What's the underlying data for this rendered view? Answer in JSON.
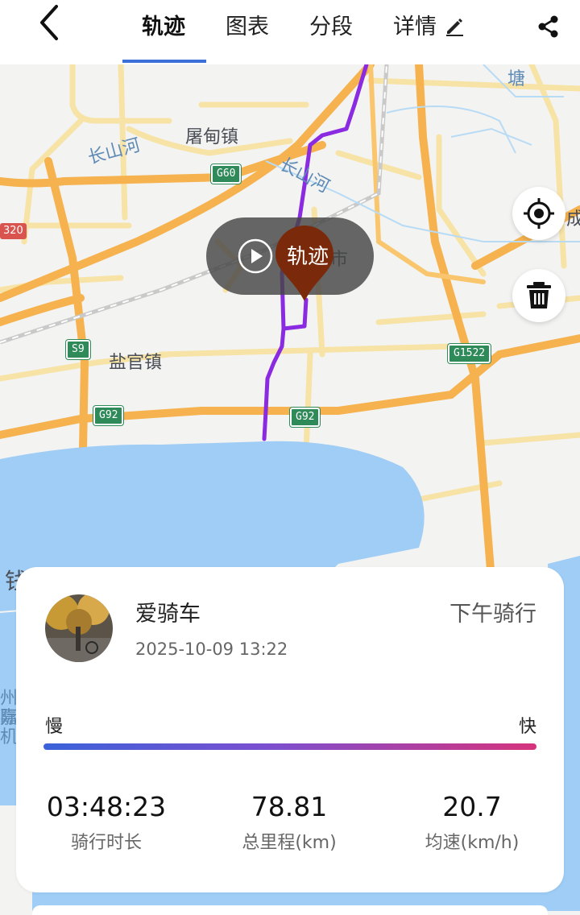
{
  "header": {
    "tabs": [
      {
        "label": "轨迹"
      },
      {
        "label": "图表"
      },
      {
        "label": "分段"
      },
      {
        "label": "详情"
      }
    ]
  },
  "map": {
    "places": [
      "屠甸镇",
      "盐官镇",
      "市",
      "钱塘"
    ],
    "rivers": [
      "长山河",
      "长山河"
    ],
    "roads": [
      "G60",
      "S9",
      "G92",
      "G92",
      "G1522",
      "320"
    ],
    "edge_text": [
      "成",
      "塘",
      "州嘉",
      "际机"
    ],
    "play_label": "轨迹"
  },
  "ride": {
    "user_name": "爱骑车",
    "datetime": "2025-10-09 13:22",
    "ride_type": "下午骑行",
    "speed_slow": "慢",
    "speed_fast": "快",
    "stats": [
      {
        "value": "03:48:23",
        "label": "骑行时长"
      },
      {
        "value": "78.81",
        "label": "总里程(km)"
      },
      {
        "value": "20.7",
        "label": "均速(km/h)"
      }
    ]
  },
  "colors": {
    "accent": "#3d6fd8",
    "track": "#8a2be2",
    "water": "#9fcdf5",
    "highway": "#f5b24e",
    "marker": "#7a2a0a"
  }
}
